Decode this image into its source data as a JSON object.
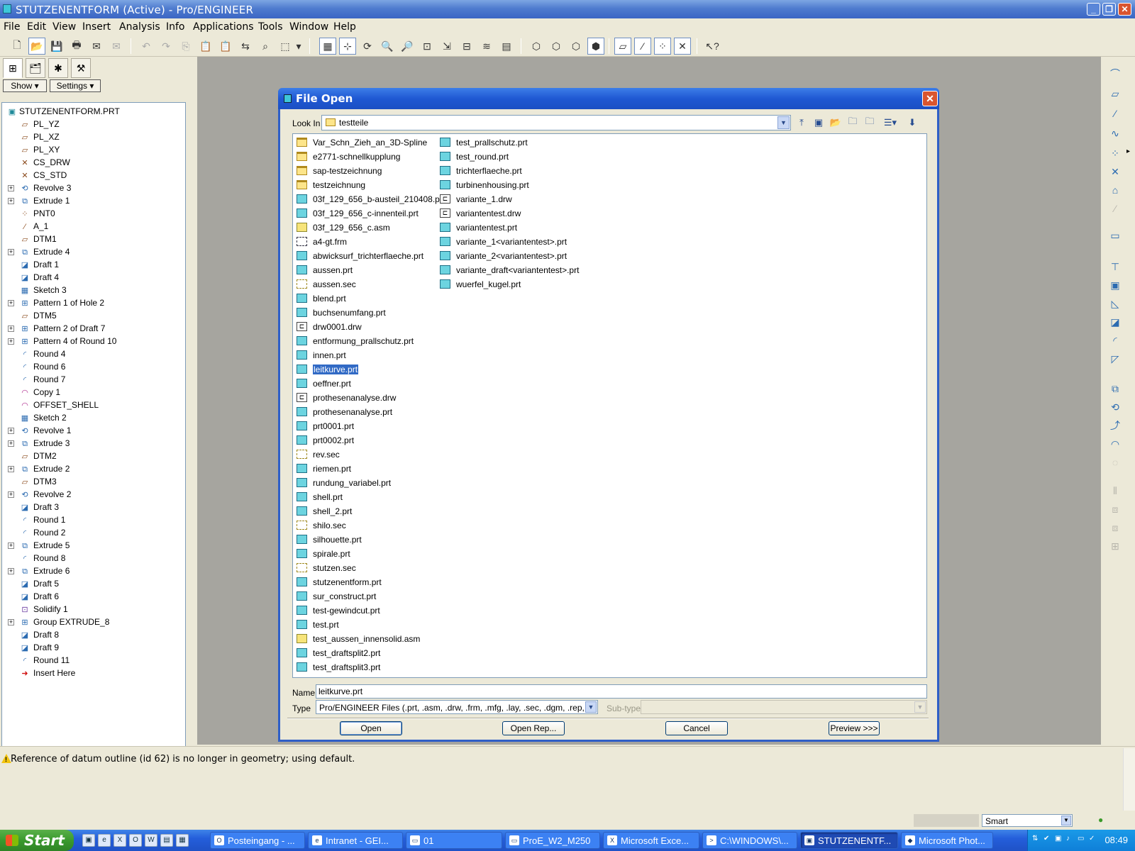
{
  "window": {
    "title": "STUTZENENTFORM (Active) - Pro/ENGINEER"
  },
  "menu": [
    "File",
    "Edit",
    "View",
    "Insert",
    "Analysis",
    "Info",
    "Applications",
    "Tools",
    "Window",
    "Help"
  ],
  "left_panel": {
    "show_button": "Show",
    "settings_button": "Settings",
    "tree": [
      {
        "label": "STUTZENENTFORM.PRT",
        "icon": "part-icon",
        "root": true
      },
      {
        "label": "PL_YZ",
        "icon": "datum-plane-icon"
      },
      {
        "label": "PL_XZ",
        "icon": "datum-plane-icon"
      },
      {
        "label": "PL_XY",
        "icon": "datum-plane-icon"
      },
      {
        "label": "CS_DRW",
        "icon": "coord-sys-icon"
      },
      {
        "label": "CS_STD",
        "icon": "coord-sys-icon"
      },
      {
        "label": "Revolve 3",
        "icon": "revolve-icon",
        "expandable": true
      },
      {
        "label": "Extrude 1",
        "icon": "extrude-icon",
        "expandable": true
      },
      {
        "label": "PNT0",
        "icon": "datum-point-icon"
      },
      {
        "label": "A_1",
        "icon": "datum-axis-icon"
      },
      {
        "label": "DTM1",
        "icon": "datum-plane-icon"
      },
      {
        "label": "Extrude 4",
        "icon": "extrude-icon",
        "expandable": true
      },
      {
        "label": "Draft 1",
        "icon": "draft-icon"
      },
      {
        "label": "Draft 4",
        "icon": "draft-icon"
      },
      {
        "label": "Sketch 3",
        "icon": "sketch-icon"
      },
      {
        "label": "Pattern 1 of Hole 2",
        "icon": "pattern-icon",
        "expandable": true
      },
      {
        "label": "DTM5",
        "icon": "datum-plane-icon"
      },
      {
        "label": "Pattern 2 of Draft 7",
        "icon": "pattern-icon",
        "expandable": true
      },
      {
        "label": "Pattern 4 of Round 10",
        "icon": "pattern-icon",
        "expandable": true
      },
      {
        "label": "Round 4",
        "icon": "round-icon"
      },
      {
        "label": "Round 6",
        "icon": "round-icon"
      },
      {
        "label": "Round 7",
        "icon": "round-icon"
      },
      {
        "label": "Copy 1",
        "icon": "copy-icon"
      },
      {
        "label": "OFFSET_SHELL",
        "icon": "offset-icon"
      },
      {
        "label": "Sketch 2",
        "icon": "sketch-icon"
      },
      {
        "label": "Revolve 1",
        "icon": "revolve-icon",
        "expandable": true
      },
      {
        "label": "Extrude 3",
        "icon": "extrude-icon",
        "expandable": true
      },
      {
        "label": "DTM2",
        "icon": "datum-plane-icon"
      },
      {
        "label": "Extrude 2",
        "icon": "extrude-icon",
        "expandable": true
      },
      {
        "label": "DTM3",
        "icon": "datum-plane-icon"
      },
      {
        "label": "Revolve 2",
        "icon": "revolve-icon",
        "expandable": true
      },
      {
        "label": "Draft 3",
        "icon": "draft-icon"
      },
      {
        "label": "Round 1",
        "icon": "round-icon"
      },
      {
        "label": "Round 2",
        "icon": "round-icon"
      },
      {
        "label": "Extrude 5",
        "icon": "extrude-icon",
        "expandable": true
      },
      {
        "label": "Round 8",
        "icon": "round-icon"
      },
      {
        "label": "Extrude 6",
        "icon": "extrude-icon",
        "expandable": true
      },
      {
        "label": "Draft 5",
        "icon": "draft-icon"
      },
      {
        "label": "Draft 6",
        "icon": "draft-icon"
      },
      {
        "label": "Solidify 1",
        "icon": "solidify-icon"
      },
      {
        "label": "Group EXTRUDE_8",
        "icon": "group-icon",
        "expandable": true
      },
      {
        "label": "Draft 8",
        "icon": "draft-icon"
      },
      {
        "label": "Draft 9",
        "icon": "draft-icon"
      },
      {
        "label": "Round 11",
        "icon": "round-icon"
      },
      {
        "label": "Insert Here",
        "icon": "insert-here-arrow-icon"
      }
    ]
  },
  "dialog": {
    "title": "File Open",
    "look_in_label": "Look In",
    "look_in_value": "testteile",
    "files_col1": [
      {
        "name": "Var_Schn_Zieh_an_3D-Spline",
        "type": "folder"
      },
      {
        "name": "e2771-schnellkupplung",
        "type": "folder"
      },
      {
        "name": "sap-testzeichnung",
        "type": "folder"
      },
      {
        "name": "testzeichnung",
        "type": "folder"
      },
      {
        "name": "03f_129_656_b-austeil_210408.prt",
        "type": "prt"
      },
      {
        "name": "03f_129_656_c-innenteil.prt",
        "type": "prt"
      },
      {
        "name": "03f_129_656_c.asm",
        "type": "asm"
      },
      {
        "name": "a4-gt.frm",
        "type": "frm"
      },
      {
        "name": "abwicksurf_trichterflaeche.prt",
        "type": "prt"
      },
      {
        "name": "aussen.prt",
        "type": "prt"
      },
      {
        "name": "aussen.sec",
        "type": "sec"
      },
      {
        "name": "blend.prt",
        "type": "prt"
      },
      {
        "name": "buchsenumfang.prt",
        "type": "prt"
      },
      {
        "name": "drw0001.drw",
        "type": "drw"
      },
      {
        "name": "entformung_prallschutz.prt",
        "type": "prt"
      },
      {
        "name": "innen.prt",
        "type": "prt"
      },
      {
        "name": "leitkurve.prt",
        "type": "prt",
        "selected": true
      },
      {
        "name": "oeffner.prt",
        "type": "prt"
      },
      {
        "name": "prothesenanalyse.drw",
        "type": "drw"
      },
      {
        "name": "prothesenanalyse.prt",
        "type": "prt"
      },
      {
        "name": "prt0001.prt",
        "type": "prt"
      },
      {
        "name": "prt0002.prt",
        "type": "prt"
      },
      {
        "name": "rev.sec",
        "type": "sec"
      },
      {
        "name": "riemen.prt",
        "type": "prt"
      },
      {
        "name": "rundung_variabel.prt",
        "type": "prt"
      },
      {
        "name": "shell.prt",
        "type": "prt"
      },
      {
        "name": "shell_2.prt",
        "type": "prt"
      },
      {
        "name": "shilo.sec",
        "type": "sec"
      },
      {
        "name": "silhouette.prt",
        "type": "prt"
      },
      {
        "name": "spirale.prt",
        "type": "prt"
      },
      {
        "name": "stutzen.sec",
        "type": "sec"
      },
      {
        "name": "stutzenentform.prt",
        "type": "prt"
      },
      {
        "name": "sur_construct.prt",
        "type": "prt"
      },
      {
        "name": "test-gewindcut.prt",
        "type": "prt"
      },
      {
        "name": "test.prt",
        "type": "prt"
      },
      {
        "name": "test_aussen_innensolid.asm",
        "type": "asm"
      },
      {
        "name": "test_draftsplit2.prt",
        "type": "prt"
      },
      {
        "name": "test_draftsplit3.prt",
        "type": "prt"
      }
    ],
    "files_col2": [
      {
        "name": "test_prallschutz.prt",
        "type": "prt"
      },
      {
        "name": "test_round.prt",
        "type": "prt"
      },
      {
        "name": "trichterflaeche.prt",
        "type": "prt"
      },
      {
        "name": "turbinenhousing.prt",
        "type": "prt"
      },
      {
        "name": "variante_1.drw",
        "type": "drw"
      },
      {
        "name": "variantentest.drw",
        "type": "drw"
      },
      {
        "name": "variantentest.prt",
        "type": "prt"
      },
      {
        "name": "variante_1<variantentest>.prt",
        "type": "prt"
      },
      {
        "name": "variante_2<variantentest>.prt",
        "type": "prt"
      },
      {
        "name": "variante_draft<variantentest>.prt",
        "type": "prt"
      },
      {
        "name": "wuerfel_kugel.prt",
        "type": "prt"
      }
    ],
    "name_label": "Name",
    "name_value": "leitkurve.prt",
    "type_label": "Type",
    "type_value": "Pro/ENGINEER Files (.prt, .asm, .drw, .frm, .mfg, .lay, .sec, .dgm, .rep, .mrk, .int,",
    "subtype_label": "Sub-type",
    "buttons": {
      "open": "Open",
      "open_rep": "Open Rep...",
      "cancel": "Cancel",
      "preview": "Preview >>>"
    }
  },
  "message": "Reference of datum outline (id 62) is no longer in geometry; using default.",
  "status": {
    "filter": "Smart"
  },
  "taskbar": {
    "start": "Start",
    "tasks": [
      {
        "label": "Posteingang - ...",
        "icon": "outlook-icon"
      },
      {
        "label": "Intranet - GEI...",
        "icon": "browser-icon"
      },
      {
        "label": "01",
        "icon": "folder-icon"
      },
      {
        "label": "ProE_W2_M250",
        "icon": "folder-icon"
      },
      {
        "label": "Microsoft Exce...",
        "icon": "excel-icon"
      },
      {
        "label": "C:\\WINDOWS\\...",
        "icon": "cmd-icon"
      },
      {
        "label": "STUTZENENTF...",
        "icon": "proe-icon",
        "active": true
      },
      {
        "label": "Microsoft Phot...",
        "icon": "photo-icon"
      }
    ],
    "clock": "08:49"
  }
}
